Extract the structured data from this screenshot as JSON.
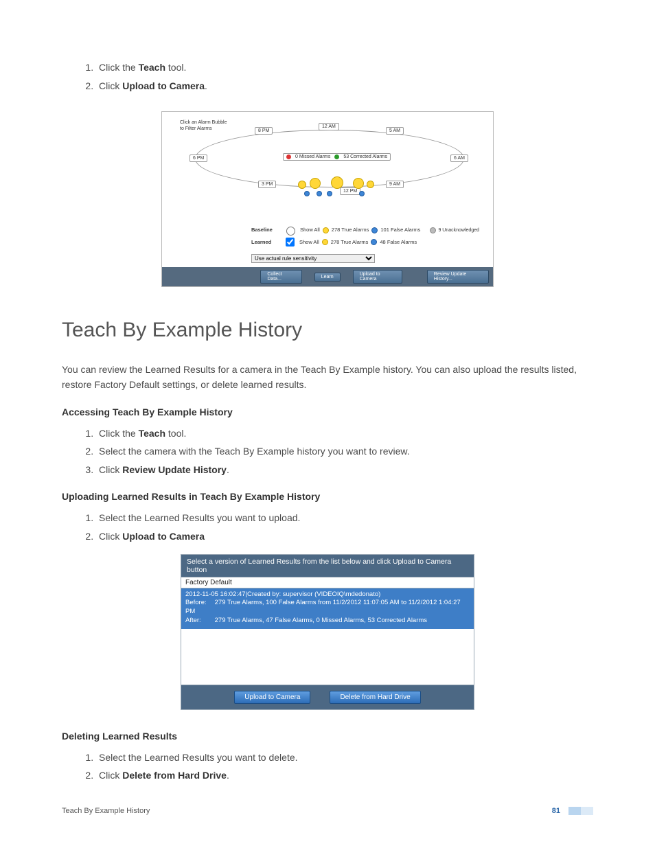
{
  "top_steps": {
    "s1_a": "Click the ",
    "s1_b": "Teach",
    "s1_c": " tool.",
    "s2_a": "Click ",
    "s2_b": "Upload to Camera",
    "s2_c": "."
  },
  "fig1": {
    "note": "Click an Alarm Bubble\nto Filter Alarms",
    "times": {
      "t0": "6 PM",
      "t1": "8 PM",
      "t2": "12 AM",
      "t3": "5 AM",
      "t4": "6 AM",
      "t5": "3 PM",
      "t6": "12 PM",
      "t7": "9 AM"
    },
    "center_legend": {
      "missed": "0 Missed Alarms",
      "corrected": "53 Corrected Alarms"
    },
    "baseline_label": "Baseline",
    "learned_label": "Learned",
    "show_all": "Show All",
    "baseline_true": "278 True Alarms",
    "baseline_false": "101 False Alarms",
    "learned_true": "278 True Alarms",
    "learned_false": "48  False Alarms",
    "unack": "9 Unacknowledged",
    "dropdown": "Use actual rule sensitivity",
    "btn_collect": "Collect Data...",
    "btn_learn": "Learn",
    "btn_upload": "Upload to Camera",
    "btn_review": "Review Update History..."
  },
  "heading": "Teach By Example History",
  "intro": "You can review the Learned Results for a camera in the Teach By Example history. You can also upload the results listed, restore Factory Default settings, or delete learned results.",
  "access_head": "Accessing Teach By Example History",
  "access": {
    "s1_a": "Click the ",
    "s1_b": "Teach",
    "s1_c": " tool.",
    "s2": "Select the camera with the Teach By Example history you want to review.",
    "s3_a": "Click ",
    "s3_b": "Review Update History",
    "s3_c": "."
  },
  "upload_head": "Uploading Learned Results in Teach By Example History",
  "upload": {
    "s1": "Select the Learned Results you want to upload.",
    "s2_a": "Click ",
    "s2_b": "Upload to Camera"
  },
  "fig2": {
    "hdr": "Select a version of Learned Results from the list below and click Upload to Camera button",
    "opt1": "Factory Default",
    "line1": "2012-11-05 16:02:47|Created by: supervisor (VIDEOIQ\\mdedonato)",
    "before_lbl": "Before:",
    "before_val": "279 True Alarms, 100 False Alarms from 11/2/2012 11:07:05 AM to 11/2/2012 1:04:27 PM",
    "after_lbl": "After:",
    "after_val": "279 True Alarms, 47 False Alarms, 0 Missed Alarms, 53 Corrected Alarms",
    "btn_upload": "Upload to Camera",
    "btn_delete": "Delete from Hard Drive"
  },
  "delete_head": "Deleting Learned Results",
  "delete": {
    "s1": "Select the Learned Results you want to delete.",
    "s2_a": "Click ",
    "s2_b": "Delete from Hard Drive",
    "s2_c": "."
  },
  "footer": {
    "title": "Teach By Example History",
    "page": "81"
  }
}
